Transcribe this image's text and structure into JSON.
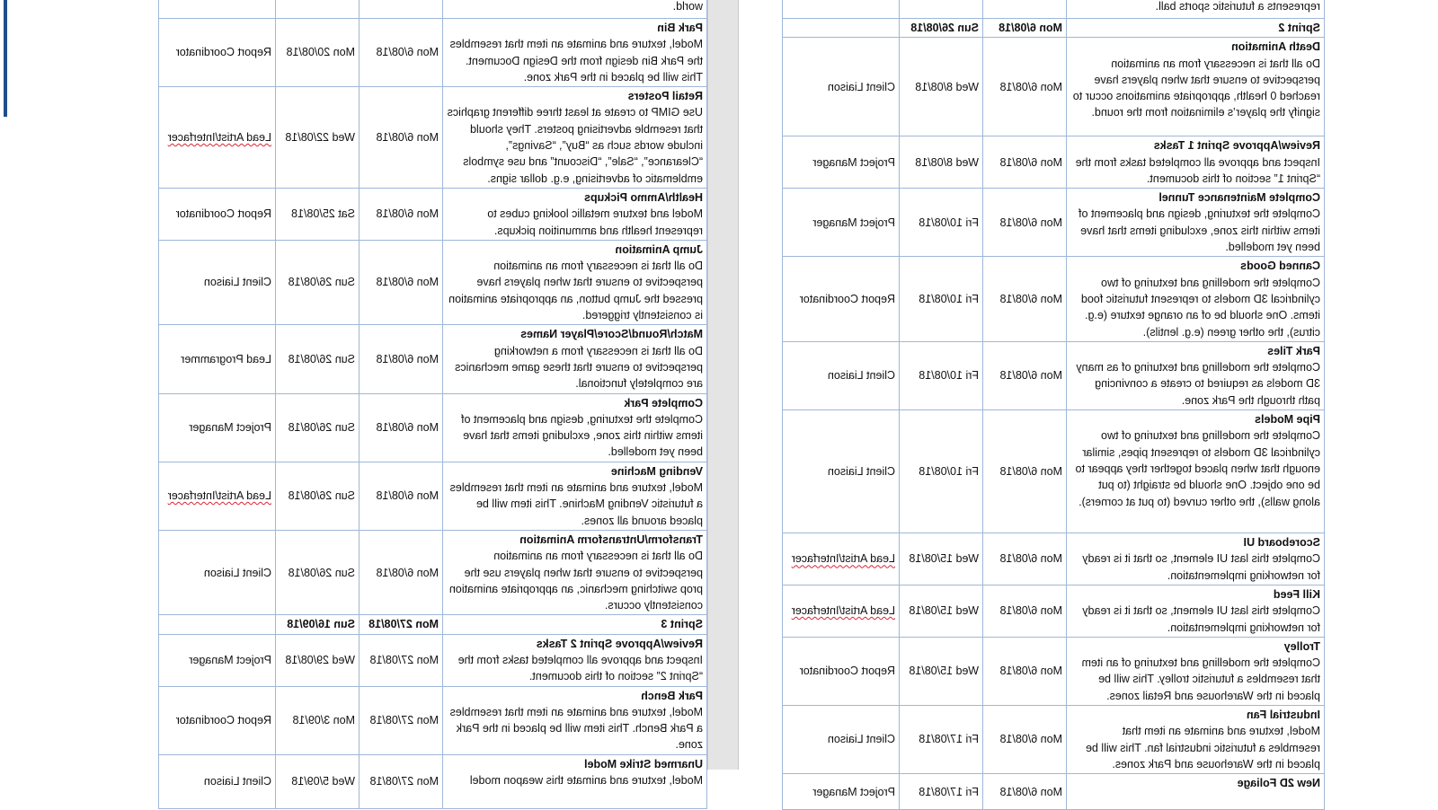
{
  "window": {
    "scrollbar": "vertical-scrollbar"
  },
  "left_page": {
    "top_fragment": "represents a futuristic sports ball.",
    "rows": [
      {
        "type": "sprint",
        "title": "Sprint 2",
        "start": "Mon 6/08/18",
        "end": "Sun 26/08/18"
      },
      {
        "type": "task",
        "title": "Death Animation",
        "desc": "Do all that is necessary from an animation perspective to ensure that when players have reached 0 health, appropriate animations occur to signify the player’s elimination from the round.",
        "start": "Mon 6/08/18",
        "end": "Wed 8/08/18",
        "role": "Client Liaison"
      },
      {
        "type": "task",
        "title": "Review/Approve Sprint 1 Tasks",
        "desc": "Inspect and approve all completed tasks from the “Sprint 1” section of this document.",
        "start": "Mon 6/08/18",
        "end": "Wed 8/08/18",
        "role": "Project Manager"
      },
      {
        "type": "task",
        "title": "Complete Maintenance Tunnel",
        "desc": "Complete the texturing, design and placement of items within this zone, excluding items that have been yet modelled.",
        "start": "Mon 6/08/18",
        "end": "Fri 10/08/18",
        "role": "Project Manager"
      },
      {
        "type": "task",
        "title": "Canned Goods",
        "desc": "Complete the modelling and texturing of two cylindrical 3D models to represent futuristic food items. One should be of an orange texture (e.g. citrus), the other green (e.g. lentils).",
        "start": "Mon 6/08/18",
        "end": "Fri 10/08/18",
        "role": "Report Coordinator"
      },
      {
        "type": "task",
        "title": "Park Tiles",
        "desc": "Complete the modelling and texturing of as many 3D models as required to create a convincing path through the Park zone.",
        "start": "Mon 6/08/18",
        "end": "Fri 10/08/18",
        "role": "Client Liaison"
      },
      {
        "type": "task",
        "title": "Pipe Models",
        "desc": "Complete the modelling and texturing of two cylindrical 3D models to represent pipes, similar enough that when placed together they appear to be one object. One should be straight (to put along walls), the other curved (to put at corners).",
        "start": "Mon 6/08/18",
        "end": "Fri 10/08/18",
        "role": "Client Liaison"
      },
      {
        "type": "task",
        "title": "Scoreboard UI",
        "desc": "Complete this last UI element, so that it is ready for networking implementation.",
        "start": "Mon 6/08/18",
        "end": "Wed 15/08/18",
        "role": "Lead Artist/Interfacer"
      },
      {
        "type": "task",
        "title": "Kill Feed",
        "desc": "Complete this last UI element, so that it is ready for networking implementation.",
        "start": "Mon 6/08/18",
        "end": "Wed 15/08/18",
        "role": "Lead Artist/Interfacer"
      },
      {
        "type": "task",
        "title": "Trolley",
        "desc": "Complete the modelling and texturing of an item that resembles a futuristic trolley. This will be placed in the Warehouse and Retail zones.",
        "start": "Mon 6/08/18",
        "end": "Wed 15/08/18",
        "role": "Report Coordinator"
      },
      {
        "type": "task",
        "title": "Industrial Fan",
        "desc": "Model, texture and animate an item that resembles a futuristic industrial fan. This will be placed in the Warehouse and Park zones.",
        "start": "Mon 6/08/18",
        "end": "Fri 17/08/18",
        "role": "Client Liaison"
      },
      {
        "type": "task",
        "title": "New 2D Foliage",
        "desc": "",
        "start": "Mon 6/08/18",
        "end": "Fri 17/08/18",
        "role": "Project Manager"
      }
    ]
  },
  "right_page": {
    "top_fragment": "world.",
    "rows": [
      {
        "type": "task",
        "title": "Park Bin",
        "desc": "Model, texture and animate an item that resembles the Park Bin design from the Design Document. This will be placed in the Park zone.",
        "start": "Mon 6/08/18",
        "end": "Mon 20/08/18",
        "role": "Report Coordinator"
      },
      {
        "type": "task",
        "title": "Retail Posters",
        "desc": "Use GIMP to create at least three different graphics that resemble advertising posters. They should include words such as “Buy”, “Savings”, “Clearance”, “Sale”, “Discount” and use symbols emblematic of advertising, e.g. dollar signs.",
        "start": "Mon 6/08/18",
        "end": "Wed 22/08/18",
        "role": "Lead Artist/Interfacer"
      },
      {
        "type": "task",
        "title": "Health/Ammo Pickups",
        "desc": "Model and texture metallic looking cubes to represent health and ammunition pickups.",
        "start": "Mon 6/08/18",
        "end": "Sat 25/08/18",
        "role": "Report Coordinator"
      },
      {
        "type": "task",
        "title": "Jump Animation",
        "desc": "Do all that is necessary from an animation perspective to ensure that when players have pressed the Jump button, an appropriate animation is consistently triggered.",
        "start": "Mon 6/08/18",
        "end": "Sun 26/08/18",
        "role": "Client Liaison"
      },
      {
        "type": "task",
        "title": "Match/Round/Score/Player Names",
        "desc": "Do all that is necessary from a networking perspective to ensure that these game mechanics are completely functional.",
        "start": "Mon 6/08/18",
        "end": "Sun 26/08/18",
        "role": "Lead Programmer"
      },
      {
        "type": "task",
        "title": "Complete Park",
        "desc": "Complete the texturing, design and placement of items within this zone, excluding items that have been yet modelled.",
        "start": "Mon 6/08/18",
        "end": "Sun 26/08/18",
        "role": "Project Manager"
      },
      {
        "type": "task",
        "title": "Vending Machine",
        "desc": "Model, texture and animate an item that resembles a futuristic Vending Machine. This item will be placed around all zones.",
        "start": "Mon 6/08/18",
        "end": "Sun 26/08/18",
        "role": "Lead Artist/Interfacer"
      },
      {
        "type": "task",
        "title": "Transform/Untransform Animation",
        "desc": "Do all that is necessary from an animation perspective to ensure that when players use the prop switching mechanic, an appropriate animation consistently occurs.",
        "start": "Mon 6/08/18",
        "end": "Sun 26/08/18",
        "role": "Client Liaison"
      },
      {
        "type": "sprint",
        "title": "Sprint 3",
        "start": "Mon 27/08/18",
        "end": "Sun 16/09/18"
      },
      {
        "type": "task",
        "title": "Review/Approve Sprint 2 Tasks",
        "desc": "Inspect and approve all completed tasks from the “Sprint 2” section of this document.",
        "start": "Mon 27/08/18",
        "end": "Wed 29/08/18",
        "role": "Project Manager"
      },
      {
        "type": "task",
        "title": "Park Bench",
        "desc": "Model, texture and animate an item that resembles a Park Bench. This item will be placed in the Park zone.",
        "start": "Mon 27/08/18",
        "end": "Mon 3/09/18",
        "role": "Report Coordinator"
      },
      {
        "type": "task",
        "title": "Unarmed Strike Model",
        "desc": "Model, texture and animate this weapon model",
        "start": "Mon 27/08/18",
        "end": "Wed 5/09/18",
        "role": "Client Liaison"
      }
    ]
  }
}
